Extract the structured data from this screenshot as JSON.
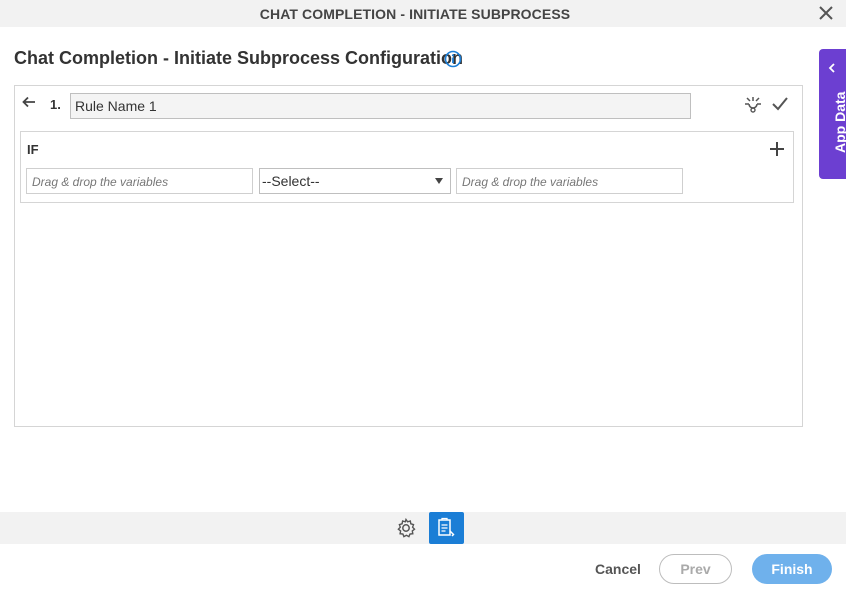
{
  "window": {
    "title": "CHAT COMPLETION - INITIATE SUBPROCESS",
    "close_icon": "close-icon"
  },
  "page": {
    "heading": "Chat Completion - Initiate Subprocess Configuration",
    "info_icon": "info-icon"
  },
  "side_tab": {
    "label": "App Data",
    "icon": "chevron-left-icon",
    "color": "#6c3fd1"
  },
  "rule": {
    "number": "1.",
    "name_value": "Rule Name 1",
    "condition_label": "IF",
    "left_operand_placeholder": "Drag & drop the variables",
    "operator_selected": "--Select--",
    "right_operand_placeholder": "Drag & drop the variables"
  },
  "footer": {
    "cancel_label": "Cancel",
    "prev_label": "Prev",
    "finish_label": "Finish",
    "accent_color": "#1b7ed6"
  }
}
